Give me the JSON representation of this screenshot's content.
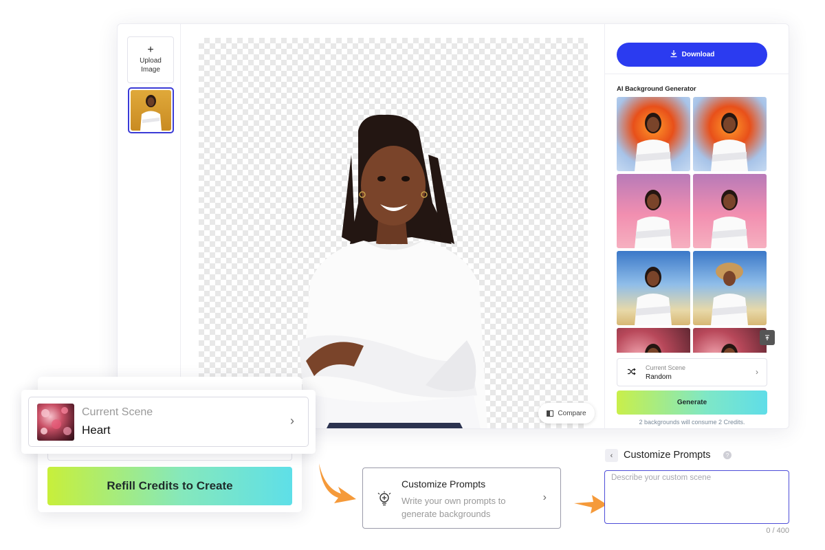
{
  "sidebar": {
    "upload_icon": "+",
    "upload_label_1": "Upload",
    "upload_label_2": "Image"
  },
  "canvas": {
    "compare_label": "Compare"
  },
  "panel": {
    "download_label": "Download",
    "section_title": "AI Background Generator",
    "current_scene_label": "Current Scene",
    "current_scene_value": "Random",
    "generate_label": "Generate",
    "consume_text": "2 backgrounds will consume 2 Credits."
  },
  "scene_card": {
    "label": "Current Scene",
    "value": "Heart"
  },
  "refill": {
    "label": "Refill Credits to Create"
  },
  "customize_card": {
    "title": "Customize Prompts",
    "description": "Write your own prompts to generate backgrounds"
  },
  "prompt_input": {
    "title": "Customize Prompts",
    "placeholder": "Describe your custom scene",
    "value": "",
    "counter": "0 / 400"
  },
  "colors": {
    "accent_blue": "#2b3bf0",
    "selection_border": "#3a3ad6",
    "arrow_orange": "#f59a3a",
    "gradient_start": "#c8ef3a",
    "gradient_end": "#5edfe8"
  }
}
